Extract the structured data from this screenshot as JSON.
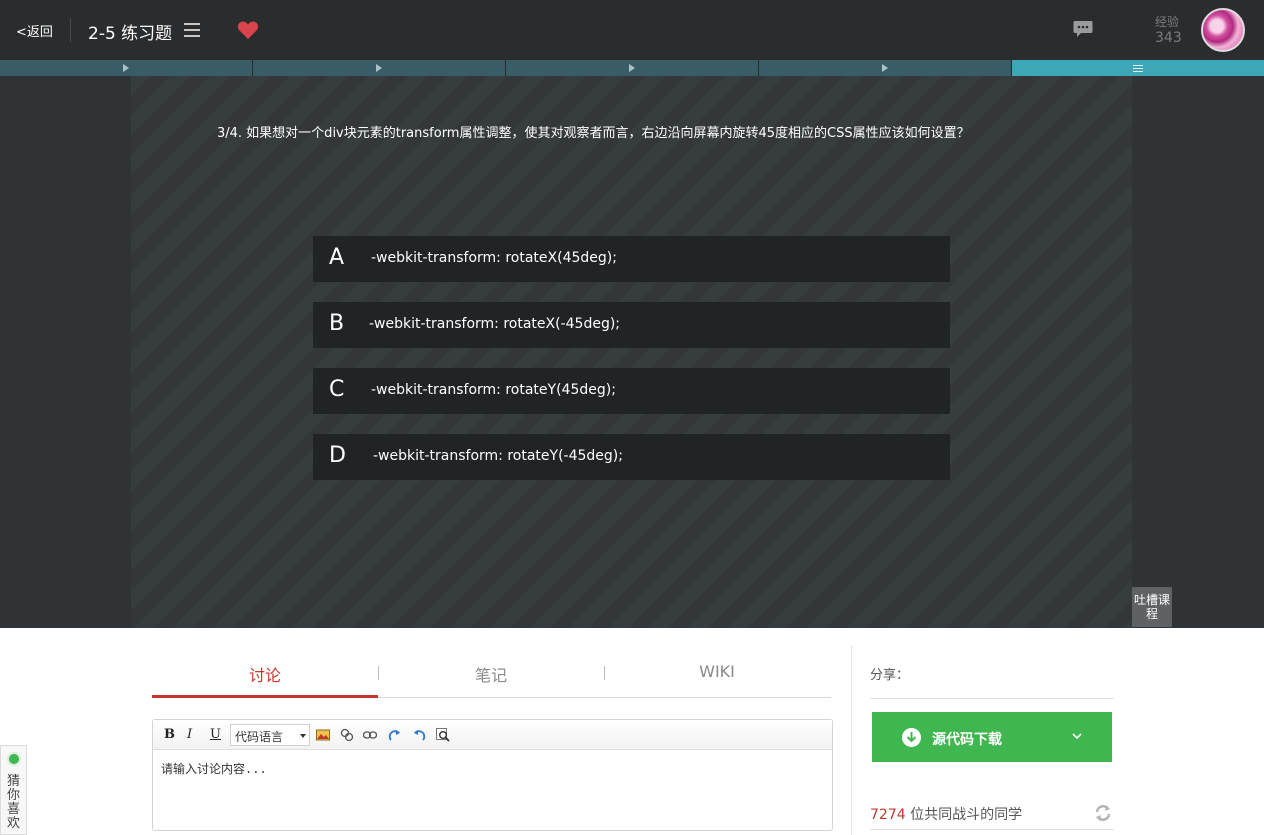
{
  "header": {
    "back_label": "<返回",
    "title": "2-5 练习题",
    "exp_label": "经验",
    "exp_value": "343"
  },
  "question": {
    "text": "3/4. 如果想对一个div块元素的transform属性调整，使其对观察者而言，右边沿向屏幕内旋转45度相应的CSS属性应该如何设置？",
    "options": [
      {
        "letter": "A",
        "text": "-webkit-transform: rotateX(45deg);"
      },
      {
        "letter": "B",
        "text": "-webkit-transform: rotateX(-45deg);"
      },
      {
        "letter": "C",
        "text": "-webkit-transform: rotateY(45deg);"
      },
      {
        "letter": "D",
        "text": "-webkit-transform: rotateY(-45deg);"
      }
    ]
  },
  "feedback_label": "吐槽课程",
  "tabs": [
    {
      "label": "讨论",
      "active": true
    },
    {
      "label": "笔记",
      "active": false
    },
    {
      "label": "WIKI",
      "active": false
    }
  ],
  "editor": {
    "bold": "B",
    "italic": "I",
    "underline": "U",
    "code_language": "代码语言",
    "placeholder": "请输入讨论内容..."
  },
  "sidebar": {
    "share_label": "分享：",
    "download_label": "源代码下载",
    "classmates_count": "7274",
    "classmates_text": " 位共同战斗的同学"
  },
  "guess_label": "猜你喜欢",
  "colors": {
    "accent_red": "#c0392b",
    "progress_active": "#3fa6b8",
    "download_green": "#3fb64f"
  }
}
